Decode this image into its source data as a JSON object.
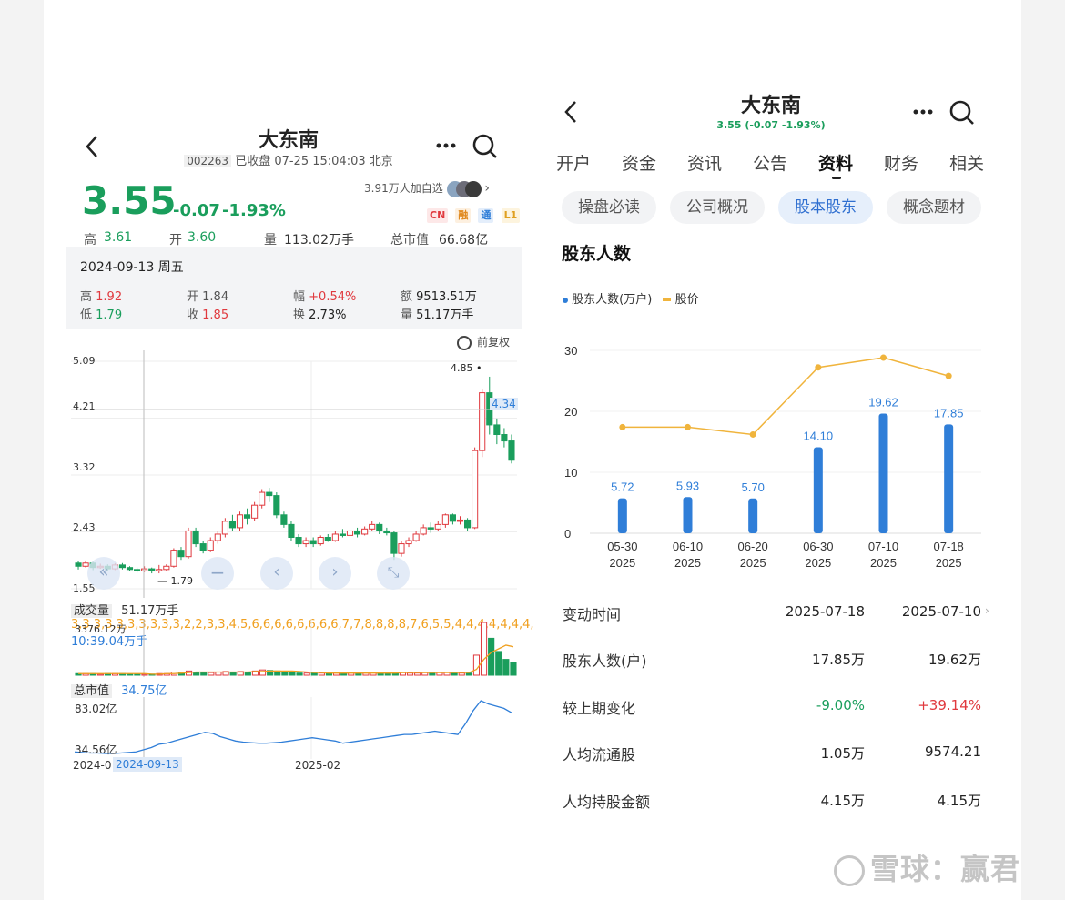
{
  "left": {
    "title": "大东南",
    "code": "002263",
    "status": "已收盘 07-25 15:04:03 北京",
    "price": "3.55",
    "change": "-0.07",
    "change_pct": "-1.93%",
    "followers": "3.91万人加自选",
    "tags": [
      "CN",
      "融",
      "通",
      "L1"
    ],
    "stats": [
      {
        "label": "高",
        "value": "3.61"
      },
      {
        "label": "开",
        "value": "3.60"
      },
      {
        "label": "量",
        "value": "113.02万手"
      },
      {
        "label": "总市值",
        "value": "66.68亿"
      }
    ],
    "tooltip": {
      "date": "2024-09-13 周五",
      "high_label": "高",
      "high": "1.92",
      "open_label": "开",
      "open": "1.84",
      "amp_label": "幅",
      "amp": "+0.54%",
      "amount_label": "额",
      "amount": "9513.51万",
      "low_label": "低",
      "low": "1.79",
      "close_label": "收",
      "close": "1.85",
      "turnover_label": "换",
      "turnover": "2.73%",
      "volume_label": "量",
      "volume": "51.17万手"
    },
    "restore_label": "前复权",
    "kline": {
      "y_ticks": [
        "5.09",
        "4.21",
        "3.32",
        "2.43",
        "1.55"
      ],
      "ylim": [
        1.55,
        5.09
      ],
      "cursor_price": "4.34",
      "max_label": "4.85",
      "min_label": "1.79",
      "candles": [
        [
          1.95,
          1.9,
          1.98,
          1.85
        ],
        [
          1.9,
          1.95,
          1.99,
          1.88
        ],
        [
          1.95,
          1.88,
          1.97,
          1.84
        ],
        [
          1.88,
          1.9,
          1.94,
          1.86
        ],
        [
          1.9,
          1.86,
          1.93,
          1.83
        ],
        [
          1.86,
          1.92,
          1.95,
          1.84
        ],
        [
          1.92,
          1.88,
          1.95,
          1.85
        ],
        [
          1.88,
          1.85,
          1.9,
          1.82
        ],
        [
          1.85,
          1.83,
          1.88,
          1.8
        ],
        [
          1.83,
          1.86,
          1.9,
          1.81
        ],
        [
          1.86,
          1.84,
          1.88,
          1.79
        ],
        [
          1.84,
          1.85,
          1.92,
          1.79
        ],
        [
          1.85,
          1.9,
          1.93,
          1.82
        ],
        [
          1.9,
          2.15,
          2.18,
          1.88
        ],
        [
          2.15,
          2.05,
          2.2,
          2.0
        ],
        [
          2.05,
          2.45,
          2.5,
          2.02
        ],
        [
          2.45,
          2.25,
          2.5,
          2.2
        ],
        [
          2.25,
          2.15,
          2.3,
          2.1
        ],
        [
          2.15,
          2.3,
          2.35,
          2.12
        ],
        [
          2.3,
          2.4,
          2.45,
          2.25
        ],
        [
          2.4,
          2.6,
          2.65,
          2.35
        ],
        [
          2.6,
          2.5,
          2.7,
          2.45
        ],
        [
          2.5,
          2.7,
          2.75,
          2.45
        ],
        [
          2.7,
          2.65,
          2.8,
          2.55
        ],
        [
          2.65,
          2.85,
          2.9,
          2.6
        ],
        [
          2.85,
          3.05,
          3.1,
          2.8
        ],
        [
          3.05,
          3.0,
          3.12,
          2.9
        ],
        [
          3.0,
          2.7,
          3.05,
          2.65
        ],
        [
          2.7,
          2.55,
          2.75,
          2.5
        ],
        [
          2.55,
          2.35,
          2.6,
          2.3
        ],
        [
          2.35,
          2.25,
          2.4,
          2.2
        ],
        [
          2.25,
          2.3,
          2.35,
          2.2
        ],
        [
          2.3,
          2.25,
          2.35,
          2.2
        ],
        [
          2.25,
          2.35,
          2.38,
          2.22
        ],
        [
          2.35,
          2.3,
          2.4,
          2.28
        ],
        [
          2.3,
          2.4,
          2.45,
          2.28
        ],
        [
          2.4,
          2.38,
          2.48,
          2.35
        ],
        [
          2.38,
          2.45,
          2.48,
          2.35
        ],
        [
          2.45,
          2.4,
          2.5,
          2.35
        ],
        [
          2.4,
          2.48,
          2.52,
          2.38
        ],
        [
          2.48,
          2.55,
          2.6,
          2.45
        ],
        [
          2.55,
          2.45,
          2.58,
          2.4
        ],
        [
          2.45,
          2.42,
          2.5,
          2.38
        ],
        [
          2.42,
          2.1,
          2.45,
          2.0
        ],
        [
          2.1,
          2.25,
          2.3,
          2.05
        ],
        [
          2.25,
          2.3,
          2.35,
          2.2
        ],
        [
          2.3,
          2.4,
          2.45,
          2.28
        ],
        [
          2.4,
          2.5,
          2.55,
          2.38
        ],
        [
          2.5,
          2.48,
          2.58,
          2.42
        ],
        [
          2.48,
          2.55,
          2.6,
          2.45
        ],
        [
          2.55,
          2.7,
          2.72,
          2.5
        ],
        [
          2.7,
          2.6,
          2.72,
          2.55
        ],
        [
          2.6,
          2.62,
          2.68,
          2.55
        ],
        [
          2.62,
          2.5,
          2.65,
          2.45
        ],
        [
          2.5,
          3.7,
          3.75,
          2.48
        ],
        [
          3.7,
          4.6,
          4.65,
          3.6
        ],
        [
          4.6,
          4.1,
          4.85,
          3.95
        ],
        [
          4.1,
          3.95,
          4.2,
          3.8
        ],
        [
          3.95,
          3.85,
          4.05,
          3.75
        ],
        [
          3.85,
          3.55,
          3.95,
          3.5
        ]
      ],
      "ma": [
        1.9,
        1.91,
        1.9,
        1.9,
        1.89,
        1.9,
        1.9,
        1.88,
        1.86,
        1.86,
        1.85,
        1.85,
        1.86,
        1.92,
        1.98,
        2.1,
        2.17,
        2.2,
        2.25,
        2.3,
        2.35,
        2.41,
        2.48,
        2.55,
        2.62,
        2.73,
        2.8,
        2.82,
        2.78,
        2.7,
        2.58,
        2.45,
        2.35,
        2.3,
        2.3,
        2.3,
        2.33,
        2.36,
        2.39,
        2.42,
        2.45,
        2.45,
        2.46,
        2.38,
        2.34,
        2.3,
        2.3,
        2.35,
        2.4,
        2.45,
        2.52,
        2.57,
        2.6,
        2.58,
        2.8,
        3.2,
        3.55,
        3.8,
        3.95,
        4.05
      ]
    },
    "volume": {
      "label": "成交量",
      "value": "51.17万手",
      "ma5": [
        3,
        3,
        3,
        3,
        3,
        3,
        3,
        3,
        3,
        3,
        2,
        2,
        3,
        3,
        4,
        5,
        6,
        6,
        6,
        6,
        6,
        6,
        6,
        6,
        7,
        7,
        8,
        8,
        8,
        8,
        7,
        6,
        5,
        5,
        4,
        4,
        4,
        4,
        4,
        4,
        4,
        4,
        4,
        4,
        5,
        5,
        5,
        5,
        5,
        5,
        5,
        5,
        5,
        5,
        11,
        30,
        43,
        50,
        57,
        54
      ],
      "ma10": "10:39.04万手",
      "max_label": "3376.12万",
      "values": [
        3,
        3,
        3,
        2,
        3,
        3,
        3,
        2,
        2,
        2,
        2,
        3,
        3,
        6,
        5,
        8,
        6,
        5,
        5,
        6,
        7,
        6,
        7,
        6,
        8,
        10,
        9,
        8,
        6,
        5,
        4,
        4,
        4,
        4,
        4,
        4,
        4,
        4,
        4,
        4,
        5,
        4,
        4,
        6,
        5,
        4,
        4,
        5,
        5,
        5,
        6,
        5,
        4,
        4,
        38,
        100,
        70,
        45,
        30,
        25
      ]
    },
    "mktcap": {
      "label": "总市值",
      "value": "34.75亿",
      "max_label": "83.02亿",
      "min_label": "34.56亿",
      "values": [
        36,
        35.5,
        35,
        35,
        34.6,
        34.56,
        35,
        35.5,
        36,
        38,
        40,
        43,
        44,
        46,
        48,
        50,
        52,
        54,
        53,
        50,
        48,
        46,
        45,
        44.5,
        44,
        44,
        44.5,
        45,
        46,
        47,
        48,
        49,
        48,
        47,
        46,
        44,
        45,
        46,
        47,
        48,
        49,
        50,
        51,
        52,
        52,
        53,
        54,
        55,
        54,
        53,
        52,
        62,
        74,
        83,
        80,
        78,
        76,
        72
      ]
    },
    "x_labels": [
      "2024-0",
      "2024-09-13",
      "2025-02"
    ],
    "nav_icons": [
      "double-left-icon",
      "zoom-out-icon",
      "chevron-left-icon",
      "chevron-right-icon",
      "expand-icon"
    ]
  },
  "right": {
    "title": "大东南",
    "subtitle": "3.55 (-0.07 -1.93%)",
    "tabs": [
      "开户",
      "资金",
      "资讯",
      "公告",
      "资料",
      "财务",
      "相关"
    ],
    "active_tab": 4,
    "pills": [
      "操盘必读",
      "公司概况",
      "股本股东",
      "概念题材"
    ],
    "active_pill": 2,
    "section_title": "股东人数",
    "legend": [
      "股东人数(万户)",
      "股价"
    ],
    "chart_data": {
      "type": "bar",
      "categories": [
        "05-30\n2025",
        "06-10\n2025",
        "06-20\n2025",
        "06-30\n2025",
        "07-10\n2025",
        "07-18\n2025"
      ],
      "series": [
        {
          "name": "股东人数(万户)",
          "type": "bar",
          "values": [
            5.72,
            5.93,
            5.7,
            14.1,
            19.62,
            17.85
          ],
          "labels": [
            "5.72",
            "5.93",
            "5.70",
            "14.10",
            "19.62",
            "17.85"
          ]
        },
        {
          "name": "股价",
          "type": "line",
          "values": [
            17.4,
            17.4,
            16.2,
            27.2,
            28.8,
            25.8
          ]
        }
      ],
      "y_ticks": [
        "30",
        "20",
        "10",
        "0"
      ],
      "ylim": [
        0,
        30
      ],
      "colors": {
        "bar": "#2f7ed8",
        "line": "#f0b43c"
      }
    },
    "table": {
      "header": {
        "label": "变动时间",
        "col1": "2025-07-18",
        "col2": "2025-07-10"
      },
      "rows": [
        {
          "label": "股东人数(户)",
          "col1": "17.85万",
          "col2": "19.62万"
        },
        {
          "label": "较上期变化",
          "col1": "-9.00%",
          "col2": "+39.14%"
        },
        {
          "label": "人均流通股",
          "col1": "1.05万",
          "col2": "9574.21"
        },
        {
          "label": "人均持股金额",
          "col1": "4.15万",
          "col2": "4.15万"
        }
      ]
    },
    "watermark": "雪球：赢君"
  }
}
